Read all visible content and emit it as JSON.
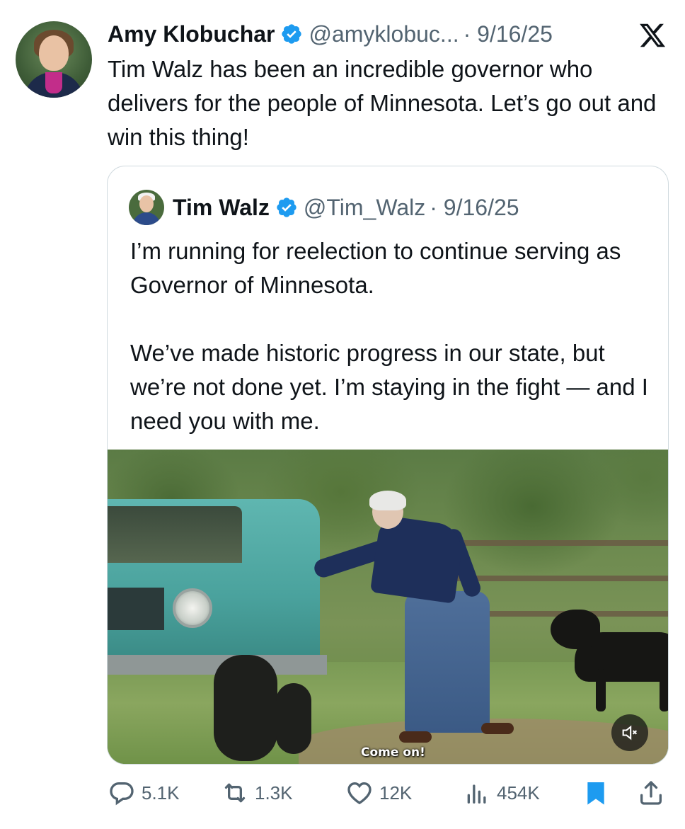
{
  "post": {
    "author_name": "Amy Klobuchar",
    "handle": "@amyklobuc...",
    "date": "· 9/16/25",
    "text": "Tim Walz has been an incredible governor who delivers for the people of Minnesota. Let’s go out and win this thing!"
  },
  "quoted": {
    "author_name": "Tim Walz",
    "handle": "@Tim_Walz",
    "date": "· 9/16/25",
    "text": "I’m running for reelection to continue serving as Governor of Minnesota.\n\nWe’ve made historic progress in our state, but we’re not done yet. I’m staying in the fight — and I need you with me.",
    "video_caption": "Come on!"
  },
  "metrics": {
    "replies": "5.1K",
    "reposts": "1.3K",
    "likes": "12K",
    "views": "454K"
  },
  "icons": {
    "verified": "verified-badge-icon",
    "platform": "x-logo-icon",
    "reply": "comment-icon",
    "repost": "repost-icon",
    "like": "heart-icon",
    "views": "analytics-icon",
    "bookmark": "bookmark-icon",
    "share": "share-icon",
    "mute": "speaker-muted-icon"
  },
  "colors": {
    "verified": "#1d9bf0",
    "bookmark": "#1d9bf0",
    "text": "#0f1419",
    "secondary": "#536471"
  }
}
